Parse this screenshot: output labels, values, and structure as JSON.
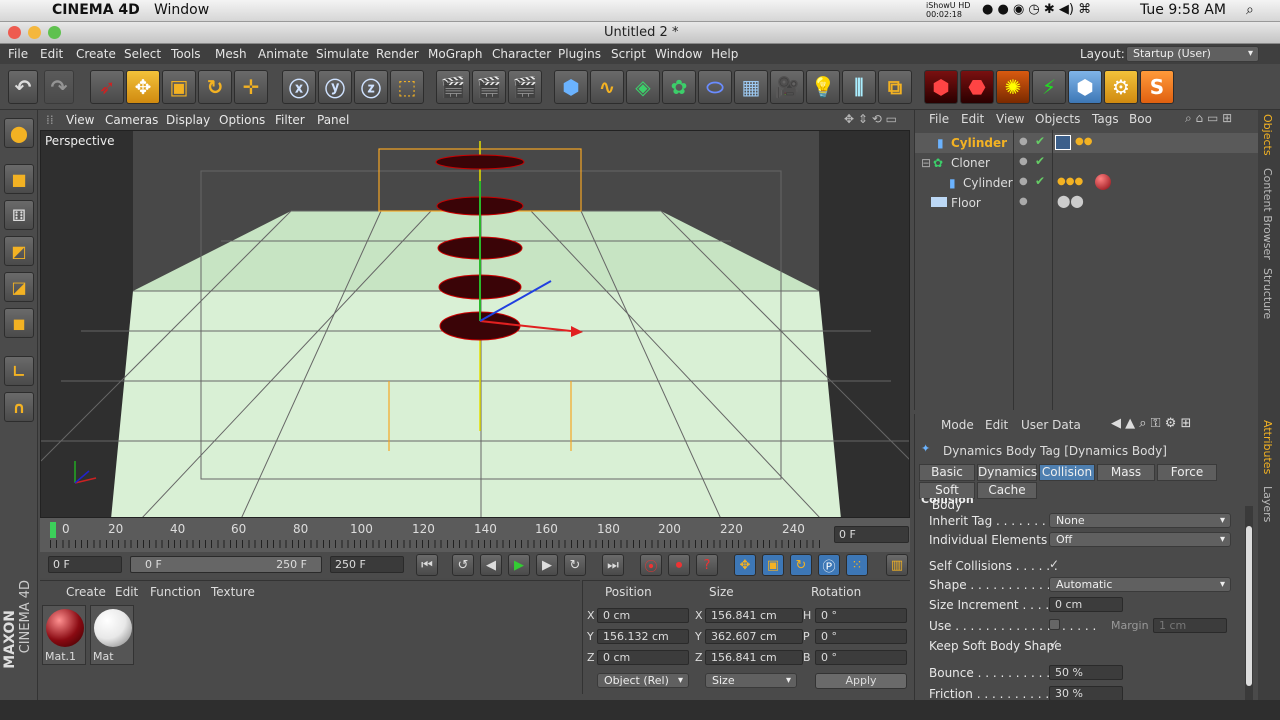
{
  "mac": {
    "app": "CINEMA 4D",
    "menu": "Window",
    "recorder": "iShowU HD",
    "rec_time": "00:02:18",
    "clock": "Tue 9:58 AM"
  },
  "window": {
    "title": "Untitled 2 *"
  },
  "menu": [
    "File",
    "Edit",
    "Create",
    "Select",
    "Tools",
    "Mesh",
    "Animate",
    "Simulate",
    "Render",
    "MoGraph",
    "Character",
    "Plugins",
    "Script",
    "Window",
    "Help"
  ],
  "layout": {
    "label": "Layout:",
    "value": "Startup (User)"
  },
  "viewport": {
    "menu": [
      "View",
      "Cameras",
      "Display",
      "Options",
      "Filter",
      "Panel"
    ],
    "label": "Perspective"
  },
  "timeline": {
    "ticks": [
      "0",
      "20",
      "40",
      "60",
      "80",
      "100",
      "120",
      "140",
      "160",
      "180",
      "200",
      "220",
      "240"
    ],
    "current": "0 F"
  },
  "transport": {
    "start": "0 F",
    "range_start": "0 F",
    "range_end": "250 F",
    "end": "250 F"
  },
  "materials": {
    "menu": [
      "Create",
      "Edit",
      "Function",
      "Texture"
    ],
    "items": [
      {
        "name": "Mat.1",
        "color": "#8a0a12"
      },
      {
        "name": "Mat",
        "color": "#e8e8e8"
      }
    ]
  },
  "coords": {
    "headers": [
      "Position",
      "Size",
      "Rotation"
    ],
    "rows": [
      {
        "axis": "X",
        "pos": "0 cm",
        "saxis": "X",
        "size": "156.841 cm",
        "raxis": "H",
        "rot": "0 °"
      },
      {
        "axis": "Y",
        "pos": "156.132 cm",
        "saxis": "Y",
        "size": "362.607 cm",
        "raxis": "P",
        "rot": "0 °"
      },
      {
        "axis": "Z",
        "pos": "0 cm",
        "saxis": "Z",
        "size": "156.841 cm",
        "raxis": "B",
        "rot": "0 °"
      }
    ],
    "mode": "Object (Rel)",
    "size_mode": "Size",
    "apply": "Apply"
  },
  "objects": {
    "menu": [
      "File",
      "Edit",
      "View",
      "Objects",
      "Tags",
      "Boo"
    ],
    "items": [
      {
        "name": "Cylinder",
        "selected": true
      },
      {
        "name": "Cloner"
      },
      {
        "name": "Cylinder"
      },
      {
        "name": "Floor"
      }
    ]
  },
  "attributes": {
    "menu": [
      "Mode",
      "Edit",
      "User Data"
    ],
    "title": "Dynamics Body Tag [Dynamics Body]",
    "tabs": [
      "Basic",
      "Dynamics",
      "Collision",
      "Mass",
      "Force",
      "Soft Body",
      "Cache"
    ],
    "section": "Collision",
    "inherit_tag": {
      "label": "Inherit Tag",
      "value": "None"
    },
    "individual": {
      "label": "Individual Elements",
      "value": "Off"
    },
    "self_collisions": {
      "label": "Self Collisions",
      "value": "✓"
    },
    "shape": {
      "label": "Shape",
      "value": "Automatic"
    },
    "size_increment": {
      "label": "Size Increment",
      "value": "0 cm"
    },
    "use": {
      "label": "Use",
      "margin_label": "Margin",
      "margin": "1 cm"
    },
    "keep_soft": {
      "label": "Keep Soft Body Shape",
      "value": "✓"
    },
    "bounce": {
      "label": "Bounce",
      "value": "50 %"
    },
    "friction": {
      "label": "Friction",
      "value": "30 %"
    }
  },
  "side_tabs": {
    "objects": "Objects",
    "content": "Content Browser",
    "structure": "Structure",
    "attributes": "Attributes",
    "layers": "Layers"
  },
  "brand": {
    "maxon": "MAXON",
    "c4d": "CINEMA 4D"
  }
}
